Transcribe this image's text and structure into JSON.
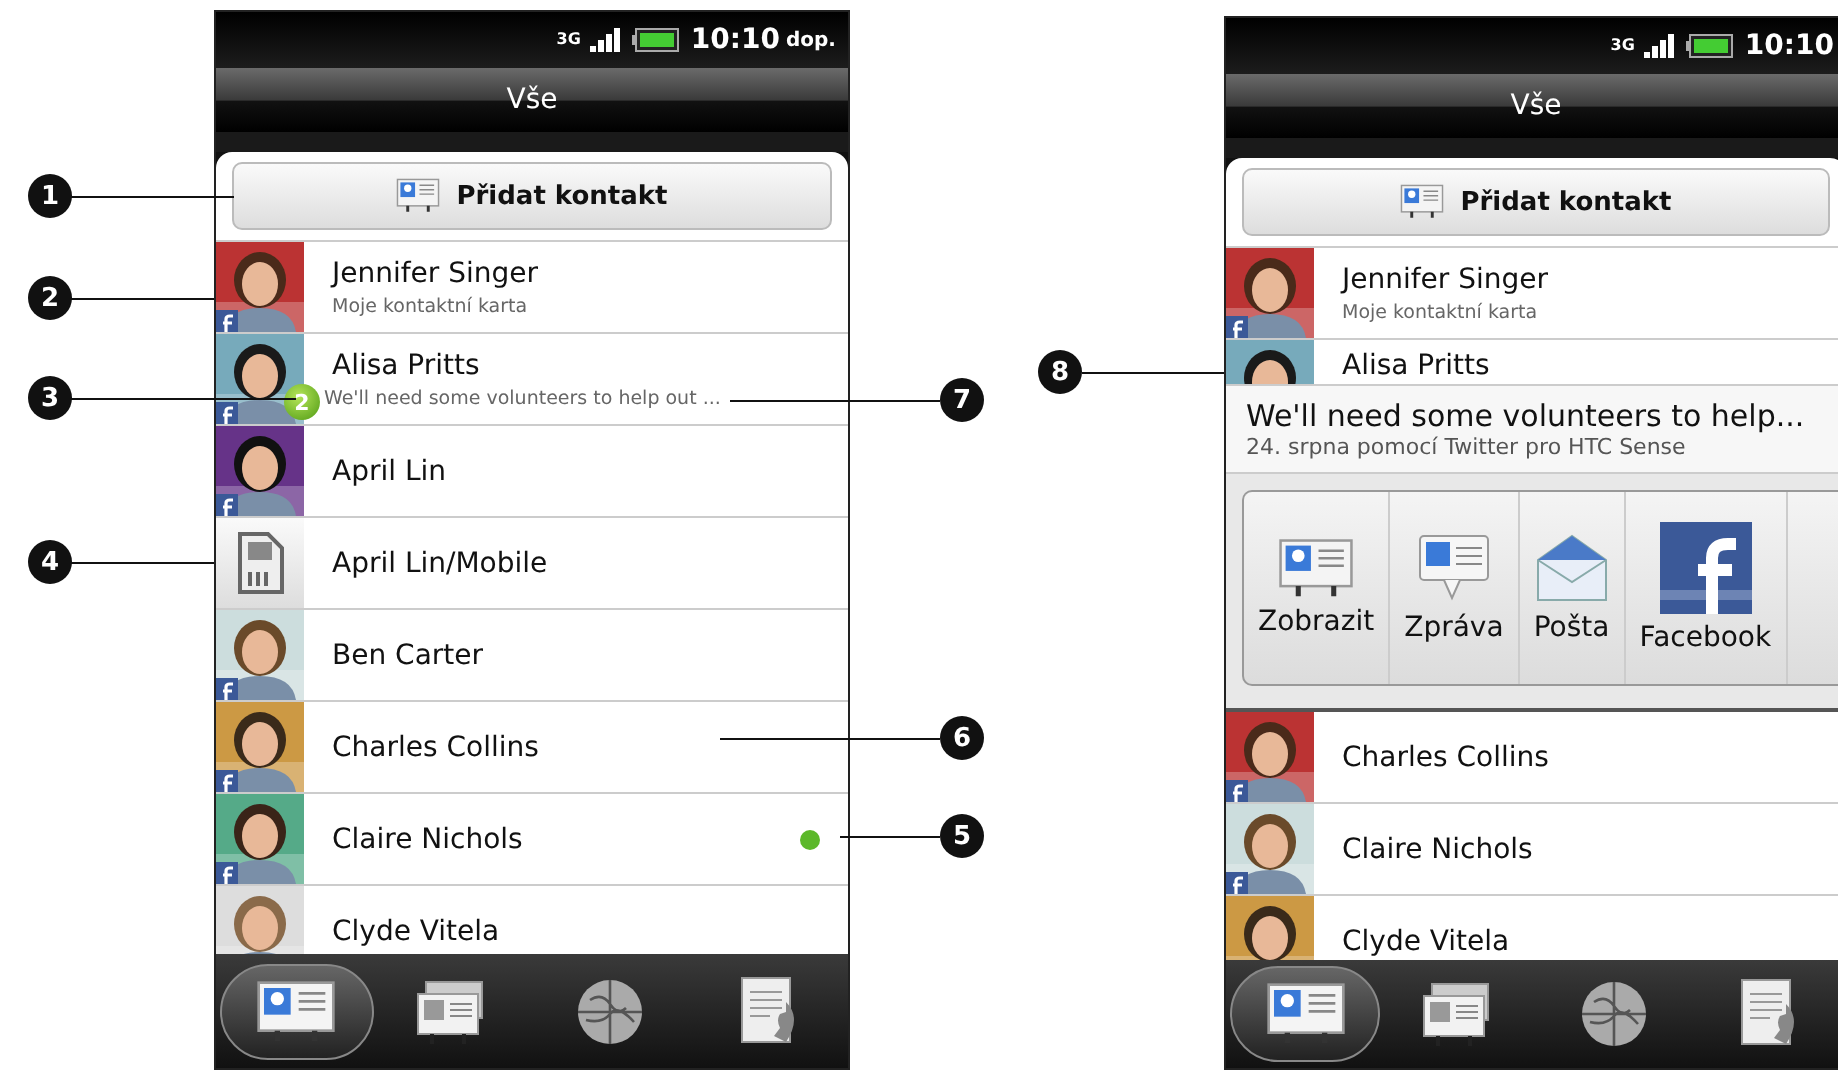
{
  "callouts_left": [
    {
      "number": "1"
    },
    {
      "number": "2"
    },
    {
      "number": "3"
    },
    {
      "number": "4"
    }
  ],
  "callouts_right": [
    {
      "number": "7"
    },
    {
      "number": "6"
    },
    {
      "number": "5"
    }
  ],
  "callout_popup": {
    "number": "8"
  },
  "phones": [
    {
      "status_bar": {
        "network": "3G",
        "time": "10:10",
        "ampm": "dop."
      },
      "title": "Vše",
      "add_button": "Přidat kontakt",
      "contacts": [
        {
          "name": "Jennifer Singer",
          "subtitle": "Moje kontaktní karta",
          "social_badge": true
        },
        {
          "name": "Alisa Pritts",
          "subtitle": "We'll need some volunteers to help out ...",
          "social_badge": true,
          "unread": "2"
        },
        {
          "name": "April Lin",
          "social_badge": true
        },
        {
          "name": "April Lin/Mobile",
          "kind": "sim",
          "social_badge": false
        },
        {
          "name": "Ben Carter",
          "social_badge": true
        },
        {
          "name": "Charles Collins",
          "social_badge": true
        },
        {
          "name": "Claire Nichols",
          "social_badge": true,
          "color": "#5cb82a"
        },
        {
          "name": "Clyde Vitela",
          "social_badge": false
        }
      ],
      "tabs": [
        {
          "kind": "contacts",
          "selected": true
        },
        {
          "kind": "groups",
          "selected": false
        },
        {
          "kind": "online",
          "selected": false
        },
        {
          "kind": "calls",
          "selected": false
        }
      ]
    },
    {
      "status_bar": {
        "network": "3G",
        "time": "10:10"
      },
      "title": "Vše",
      "add_button": "Přidat kontakt",
      "contacts": [
        {
          "name": "Jennifer Singer",
          "subtitle": "Moje kontaktní karta",
          "social_badge": true
        },
        {
          "name": "Alisa Pritts",
          "social_badge": false,
          "partial": true
        },
        {
          "kind": "popup",
          "message": "We'll need some volunteers to help...",
          "meta": "24. srpna pomocí Twitter pro HTC Sense",
          "actions": [
            {
              "label": "Zobrazit",
              "kind": "view"
            },
            {
              "label": "Zpráva",
              "kind": "message"
            },
            {
              "label": "Pošta",
              "kind": "mail"
            },
            {
              "label": "Facebook",
              "kind": "social"
            }
          ]
        },
        {
          "name": "Charles Collins",
          "social_badge": true
        },
        {
          "name": "Claire Nichols",
          "social_badge": true
        },
        {
          "name": "Clyde Vitela",
          "social_badge": false
        }
      ],
      "tabs": [
        {
          "kind": "contacts",
          "selected": true
        },
        {
          "kind": "groups",
          "selected": false
        },
        {
          "kind": "online",
          "selected": false
        },
        {
          "kind": "calls",
          "selected": false
        }
      ]
    }
  ]
}
